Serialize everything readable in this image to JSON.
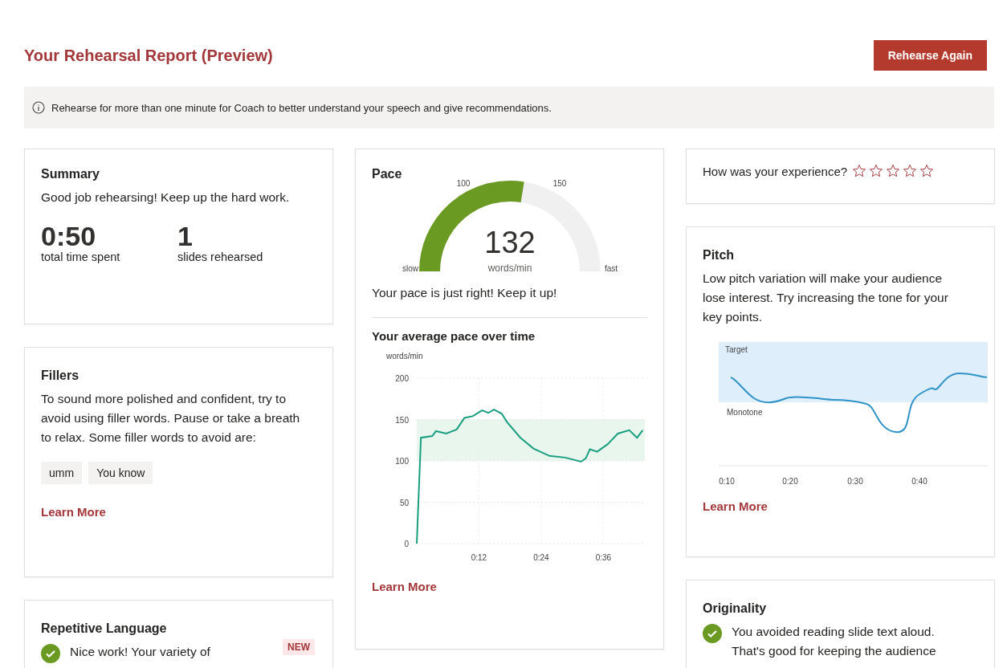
{
  "header": {
    "title": "Your Rehearsal Report (Preview)",
    "button": "Rehearse Again"
  },
  "notice": {
    "text": "Rehearse for more than one minute for Coach to better understand your speech and give recommendations."
  },
  "summary": {
    "title": "Summary",
    "text": "Good job rehearsing! Keep up the hard work.",
    "stats": [
      {
        "value": "0:50",
        "label": "total time spent"
      },
      {
        "value": "1",
        "label": "slides rehearsed"
      }
    ]
  },
  "fillers": {
    "title": "Fillers",
    "text": "To sound more polished and confident, try to avoid using filler words. Pause or take a breath to relax. Some filler words to avoid are:",
    "words": [
      "umm",
      "You know"
    ],
    "link": "Learn More"
  },
  "repetitive": {
    "title": "Repetitive Language",
    "badge": "NEW",
    "passed": true,
    "text": "Nice work! Your variety of"
  },
  "pace": {
    "title": "Pace",
    "gauge": {
      "level": 0.55,
      "value": "132",
      "unit": "words/min",
      "low_label": "slow",
      "high_label": "fast",
      "ticks": [
        "100",
        "150"
      ]
    },
    "message": "Your pace is just right! Keep it up!",
    "chart_title": "Your average pace over time",
    "chart_data": {
      "type": "line",
      "ylabel": "words/min",
      "x": [
        0,
        0.8,
        3,
        3.7,
        5.7,
        7.7,
        9.2,
        10.8,
        12.6,
        13.8,
        14.9,
        16.4,
        17.4,
        20,
        22.5,
        25.6,
        28.6,
        31.7,
        32.6,
        33.4,
        34.8,
        36.8,
        38.8,
        41,
        42.5,
        43.6
      ],
      "series": [
        {
          "color": "#1a9e80",
          "values": [
            0,
            128,
            130,
            136,
            133,
            138,
            152,
            154,
            161,
            158,
            162,
            157,
            147,
            128,
            115,
            106,
            104,
            99,
            103,
            114,
            111,
            120,
            133,
            137,
            128,
            137
          ]
        }
      ],
      "xlim": [
        0,
        44
      ],
      "ylim": [
        0,
        200
      ],
      "xticks": [
        {
          "value": 12,
          "label": "0:12"
        },
        {
          "value": 24,
          "label": "0:24"
        },
        {
          "value": 36,
          "label": "0:36"
        }
      ],
      "yticks": [
        0,
        50,
        100,
        150,
        200
      ],
      "bands": [
        {
          "axis": "y",
          "from": 100,
          "to": 150
        }
      ],
      "grid": true
    },
    "link": "Learn More"
  },
  "rating": {
    "question": "How was your experience?",
    "stars": 0
  },
  "pitch": {
    "title": "Pitch",
    "text": "Low pitch variation will make your audience lose interest. Try increasing the tone for your key points.",
    "band_top_label": "Target",
    "band_bottom_label": "Monotone",
    "x_labels": [
      "0:10",
      "0:20",
      "0:30",
      "0:40"
    ],
    "link": "Learn More"
  },
  "originality": {
    "title": "Originality",
    "passed": true,
    "text": "You avoided reading slide text aloud. That's good for keeping the audience"
  }
}
